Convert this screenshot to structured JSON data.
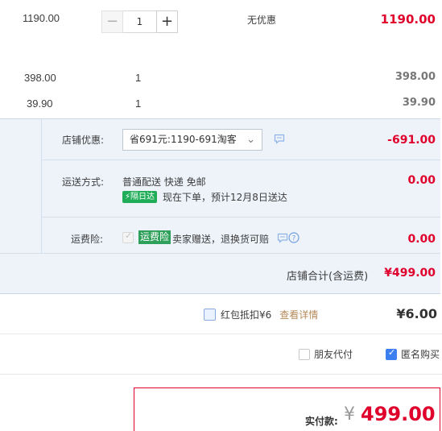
{
  "items": [
    {
      "unit_price": "1190.00",
      "quantity": "1",
      "discount": "无优惠",
      "subtotal": "1190.00"
    },
    {
      "unit_price": "398.00",
      "quantity": "1",
      "subtotal": "398.00"
    },
    {
      "unit_price": "39.90",
      "quantity": "1",
      "subtotal": "39.90"
    }
  ],
  "stepper": {
    "minus": "−",
    "plus": "+"
  },
  "shop": {
    "promo_label": "店铺优惠:",
    "promo_selected": "省691元:1190-691淘客",
    "promo_amount": "-691.00",
    "shipping_label": "运送方式:",
    "shipping_method": "普通配送 快递 免邮",
    "next_day_badge": "隔日达",
    "shipping_note": "现在下单，预计12月8日送达",
    "shipping_cost": "0.00",
    "insurance_label": "运费险:",
    "insurance_tag": "运费险",
    "insurance_desc": "卖家赠送，退换货可赔",
    "insurance_cost": "0.00",
    "total_label": "店铺合计(含运费)",
    "total_value": "¥499.00"
  },
  "red_packet": {
    "label": "红包抵扣¥6",
    "link": "查看详情",
    "amount": "¥6.00"
  },
  "options": {
    "friend_pay": "朋友代付",
    "anonymous": "匿名购买"
  },
  "payment": {
    "label": "实付款:",
    "currency": "¥",
    "amount": "499.00"
  },
  "colors": {
    "accent_red": "#e0002c",
    "panel_bg": "#eef3fa",
    "green": "#20ad58",
    "checkbox_blue": "#3c7ff0"
  }
}
